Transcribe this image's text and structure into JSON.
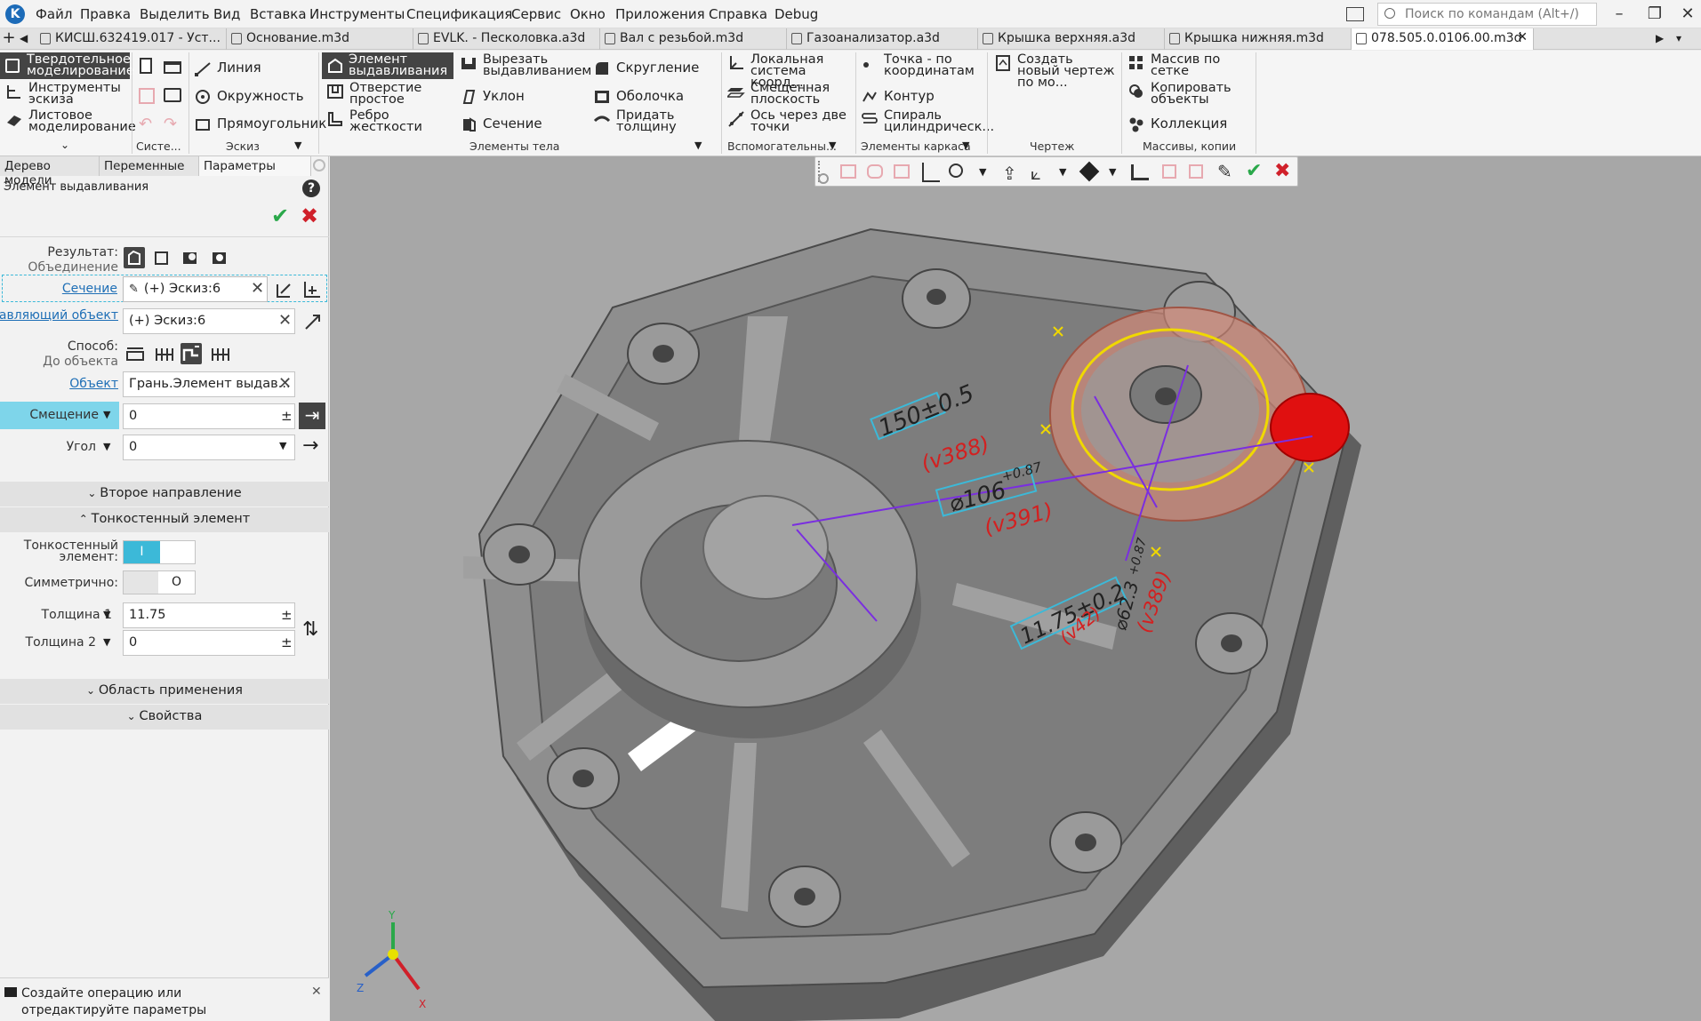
{
  "menu": {
    "items": [
      "Файл",
      "Правка",
      "Выделить",
      "Вид",
      "Вставка",
      "Инструменты",
      "Спецификация",
      "Сервис",
      "Окно",
      "Приложения",
      "Справка",
      "Debug"
    ],
    "search_placeholder": "Поиск по командам (Alt+/)"
  },
  "tabs": [
    "КИСШ.632419.017 - Уст...",
    "Основание.m3d",
    "EVLK. - Песколовка.a3d",
    "Вал с резьбой.m3d",
    "Газоанализатор.a3d",
    "Крышка верхняя.a3d",
    "Крышка нижняя.m3d",
    "078.505.0.0106.00.m3d"
  ],
  "ribbon": {
    "mode_items": [
      "Твердотельное моделирование",
      "Инструменты эскиза",
      "Листовое моделирование"
    ],
    "sketch": [
      "Линия",
      "Окружность",
      "Прямоугольник"
    ],
    "body1": [
      "Элемент выдавливания",
      "Отверстие простое",
      "Ребро жесткости"
    ],
    "body2": [
      "Вырезать выдавливанием",
      "Уклон",
      "Сечение"
    ],
    "body3": [
      "Скругление",
      "Оболочка",
      "Придать толщину"
    ],
    "aux": [
      "Локальная система коорд...",
      "Смещенная плоскость",
      "Ось через две точки"
    ],
    "frame": [
      "Точка - по координатам",
      "Контур",
      "Спираль цилиндрическ..."
    ],
    "drawing": [
      "Создать новый чертеж по мо..."
    ],
    "arrays": [
      "Массив по сетке",
      "Копировать объекты",
      "Коллекция"
    ],
    "groups": [
      "Систе...",
      "Эскиз",
      "Элементы тела",
      "Вспомогательны...",
      "Элементы каркаса",
      "Чертеж",
      "Массивы, копии"
    ]
  },
  "panel": {
    "tabs": [
      "Дерево модели",
      "Переменные",
      "Параметры"
    ],
    "title": "Элемент выдавливания",
    "result_label": "Результат:",
    "result_value": "Объединение",
    "section_label": "Сечение",
    "section_value": "(+) Эскиз:6",
    "guide_label": "Направляющий объект",
    "guide_value": "(+) Эскиз:6",
    "method_label": "Способ:",
    "method_value": "До объекта",
    "object_label": "Объект",
    "object_value": "Грань.Элемент выдав...",
    "offset_label": "Смещение",
    "offset_value": "0",
    "angle_label": "Угол",
    "angle_value": "0",
    "second_direction": "Второе направление",
    "thin_wall": "Тонкостенный элемент",
    "thin_toggle_label": "Тонкостенный элемент:",
    "thin_toggle_on": "I",
    "symmetric_label": "Симметрично:",
    "symmetric_off": "O",
    "thickness1_label": "Толщина 1",
    "thickness1_value": "11.75",
    "thickness2_label": "Толщина 2",
    "thickness2_value": "0",
    "application_area": "Область применения",
    "properties": "Свойства",
    "status": "Создайте операцию или отредактируйте параметры"
  },
  "viewport": {
    "dims": [
      "150±0.5",
      "⌀106",
      "+0.87",
      "(v388)",
      "(v391)",
      "11.75±0.2",
      "⌀62.3",
      "+0.87",
      "(v389)",
      "(v42)"
    ],
    "axes": [
      "Y",
      "Z",
      "X"
    ]
  },
  "colors": {
    "accent": "#3cb9d8",
    "check": "#2aa84a",
    "cancel": "#d0202a",
    "solid_bg": "#444444",
    "viewport_bg": "#a7a7a7"
  }
}
